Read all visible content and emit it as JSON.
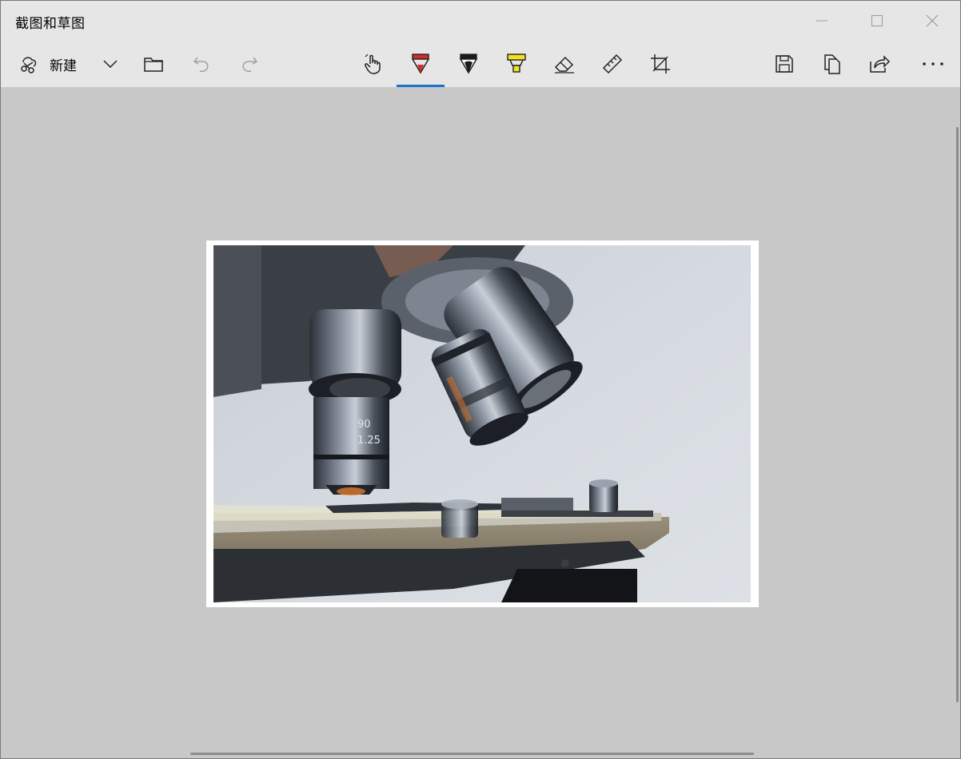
{
  "window": {
    "title": "截图和草图"
  },
  "toolbar": {
    "new_label": "新建",
    "active_tool": "ballpoint-pen",
    "accent_color": "#1a73c8"
  },
  "icons": {
    "new": "new-snip-icon",
    "dropdown": "chevron-down-icon",
    "open": "folder-icon",
    "undo": "undo-icon",
    "redo": "redo-icon",
    "touch": "touch-writing-icon",
    "pen": "ballpoint-pen-icon",
    "pencil": "pencil-icon",
    "highlighter": "highlighter-icon",
    "eraser": "eraser-icon",
    "ruler": "ruler-icon",
    "crop": "crop-icon",
    "save": "save-icon",
    "copy": "copy-icon",
    "share": "share-icon",
    "more": "more-icon"
  },
  "colors": {
    "pen": "#d42a2a",
    "pencil": "#1a1a1a",
    "highlighter": "#f2e21a",
    "canvas_bg": "#c8c8c8",
    "chrome_bg": "#e6e6e6"
  },
  "content": {
    "image_subject": "microscope"
  }
}
